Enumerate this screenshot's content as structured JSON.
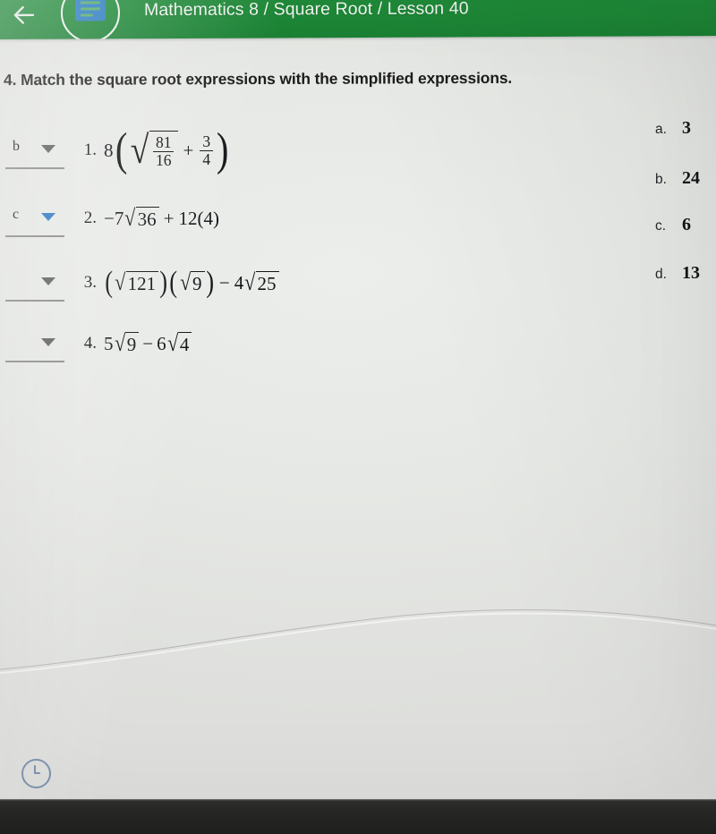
{
  "appbar": {
    "back_icon": "back-arrow-icon",
    "avatar_icon": "avatar-icon",
    "breadcrumb": "Mathematics 8 / Square Root / Lesson 40",
    "background_color": "#1d8736"
  },
  "question": {
    "number": "4.",
    "text": "Match the square root expressions with the simplified expressions."
  },
  "rows": [
    {
      "number": "1.",
      "dropdown_value": "b",
      "dropdown_state": "inactive",
      "expression_plain": "8(sqrt(81/16) + 3/4)",
      "coefficient": "8",
      "fraction_radicand": {
        "numerator": "81",
        "denominator": "16"
      },
      "operator": "+",
      "fraction_addend": {
        "numerator": "3",
        "denominator": "4"
      }
    },
    {
      "number": "2.",
      "dropdown_value": "c",
      "dropdown_state": "active",
      "expression_plain": "-7sqrt(36) + 12(4)",
      "lead": "−7",
      "radicand": "36",
      "operator": "+",
      "tail": "12(4)"
    },
    {
      "number": "3.",
      "dropdown_value": "",
      "dropdown_state": "inactive",
      "expression_plain": "(sqrt(121))(sqrt(9)) - 4sqrt(25)",
      "radicand_a": "121",
      "radicand_b": "9",
      "operator": "−",
      "coefficient_c": "4",
      "radicand_c": "25"
    },
    {
      "number": "4.",
      "dropdown_value": "",
      "dropdown_state": "inactive",
      "expression_plain": "5sqrt(9) - 6sqrt(4)",
      "coefficient_a": "5",
      "radicand_a": "9",
      "operator": "−",
      "coefficient_b": "6",
      "radicand_b": "4"
    }
  ],
  "options": [
    {
      "letter": "a.",
      "value": "3"
    },
    {
      "letter": "b.",
      "value": "24"
    },
    {
      "letter": "c.",
      "value": "6"
    },
    {
      "letter": "d.",
      "value": "13"
    }
  ],
  "footer": {
    "timer_icon": "clock-icon"
  },
  "colors": {
    "appbar_green": "#1d8736",
    "active_arrow_blue": "#2b74c4",
    "inactive_arrow_gray": "#5d5d5b",
    "page_background": "#e6e8e5",
    "timer_blue": "#6b84a6"
  }
}
